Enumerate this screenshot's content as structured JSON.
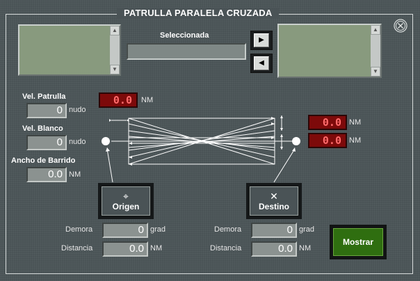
{
  "window": {
    "title": "PATRULLA PARALELA CRUZADA"
  },
  "selection": {
    "label": "Seleccionada",
    "value": ""
  },
  "nav": {
    "right_glyph": "▶",
    "left_glyph": "◀"
  },
  "left_list": {
    "items": []
  },
  "right_list": {
    "items": []
  },
  "vel_patrulla": {
    "label": "Vel. Patrulla",
    "value": "0",
    "unit": "nudo"
  },
  "vel_blanco": {
    "label": "Vel. Blanco",
    "value": "0",
    "unit": "nudo"
  },
  "ancho_barrido": {
    "label": "Ancho de Barrido",
    "value": "0.0",
    "unit": "NM"
  },
  "track_spacing": {
    "value": "0.0",
    "unit": "NM"
  },
  "right_top": {
    "value": "0.0",
    "unit": "NM"
  },
  "right_bottom": {
    "value": "0.0",
    "unit": "NM"
  },
  "origen": {
    "label": "Origen",
    "icon": "crosshair-icon",
    "demora_label": "Demora",
    "demora_value": "0",
    "demora_unit": "grad",
    "distancia_label": "Distancia",
    "distancia_value": "0.0",
    "distancia_unit": "NM"
  },
  "destino": {
    "label": "Destino",
    "icon": "x-icon",
    "demora_label": "Demora",
    "demora_value": "0",
    "demora_unit": "grad",
    "distancia_label": "Distancia",
    "distancia_value": "0.0",
    "distancia_unit": "NM"
  },
  "mostrar": {
    "label": "Mostrar"
  },
  "colors": {
    "panel": "#4a5356",
    "led": "#7d0a0a",
    "led_text": "#ff6b6b",
    "list": "#889a7e",
    "mostrar": "#2f6e10"
  }
}
